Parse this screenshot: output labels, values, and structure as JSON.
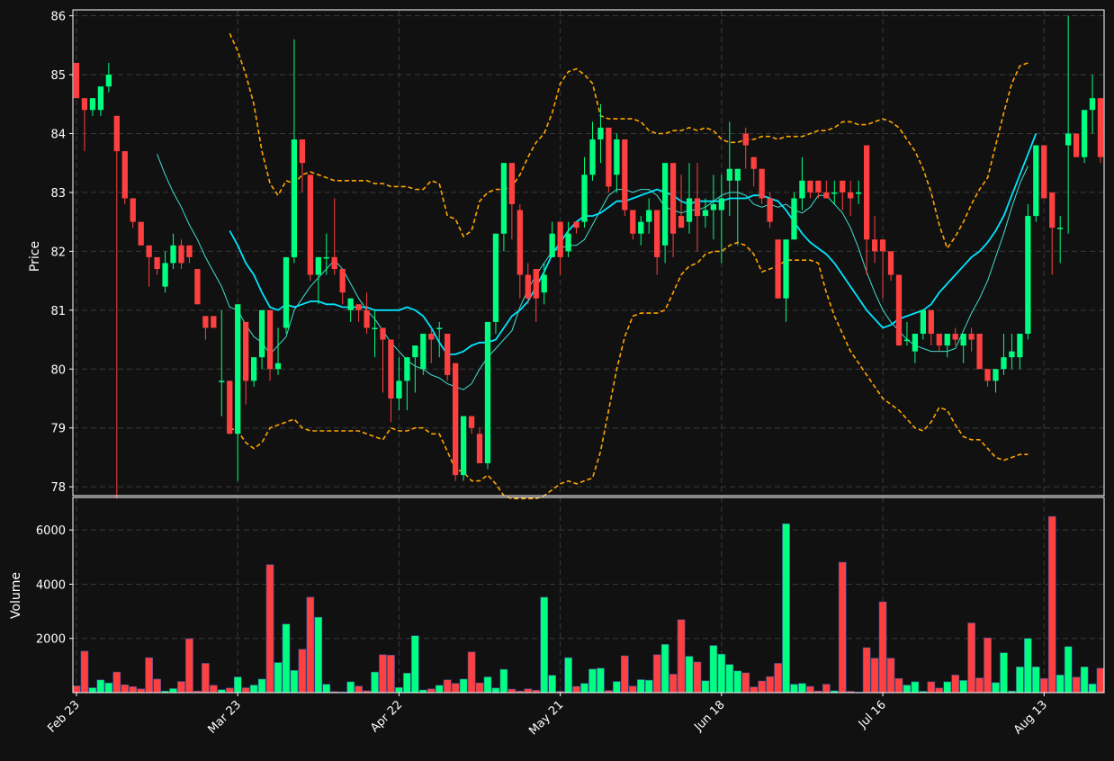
{
  "chart_data": {
    "type": "candlestick",
    "colors": {
      "background": "#111111",
      "grid": "#3a3a3a",
      "frame": "#ffffff",
      "up": "#00ff80",
      "down": "#ff4040",
      "ma_short": "#40e0d0",
      "ma_long": "#00e5ff",
      "band": "#ffa500"
    },
    "price_panel": {
      "ylabel": "Price",
      "ylim": [
        77.85,
        86.1
      ],
      "yticks": [
        78,
        79,
        80,
        81,
        82,
        83,
        84,
        85,
        86
      ]
    },
    "volume_panel": {
      "ylabel": "Volume",
      "ylim": [
        0,
        7200
      ],
      "yticks": [
        2000,
        4000,
        6000
      ]
    },
    "x_axis": {
      "ticks": [
        {
          "label": "Feb 23",
          "index": 0
        },
        {
          "label": "Mar 23",
          "index": 20
        },
        {
          "label": "Apr 22",
          "index": 40
        },
        {
          "label": "May 21",
          "index": 60
        },
        {
          "label": "Jun 18",
          "index": 80
        },
        {
          "label": "Jul 16",
          "index": 100
        },
        {
          "label": "Aug 13",
          "index": 120
        }
      ]
    },
    "candles": [
      [
        85.2,
        85.2,
        84.6,
        84.6,
        250
      ],
      [
        84.6,
        84.6,
        83.7,
        84.4,
        1530
      ],
      [
        84.4,
        84.6,
        84.3,
        84.6,
        180
      ],
      [
        84.4,
        84.8,
        84.3,
        84.8,
        470
      ],
      [
        84.8,
        85.2,
        84.7,
        85.0,
        360
      ],
      [
        84.3,
        84.3,
        77.8,
        83.7,
        760
      ],
      [
        83.7,
        83.7,
        82.8,
        82.9,
        290
      ],
      [
        82.9,
        82.9,
        82.4,
        82.5,
        220
      ],
      [
        82.5,
        82.5,
        82.1,
        82.1,
        140
      ],
      [
        82.1,
        82.1,
        81.4,
        81.9,
        1290
      ],
      [
        81.9,
        81.9,
        81.6,
        81.7,
        500
      ],
      [
        81.4,
        82.0,
        81.3,
        81.8,
        60
      ],
      [
        81.8,
        82.3,
        81.7,
        82.1,
        150
      ],
      [
        82.1,
        82.2,
        81.7,
        81.8,
        410
      ],
      [
        82.1,
        82.1,
        81.8,
        81.9,
        1990
      ],
      [
        81.7,
        81.7,
        81.1,
        81.1,
        60
      ],
      [
        80.9,
        80.9,
        80.5,
        80.7,
        1080
      ],
      [
        80.9,
        80.9,
        80.7,
        80.7,
        270
      ],
      [
        79.8,
        81.0,
        79.2,
        79.8,
        110
      ],
      [
        79.8,
        79.8,
        78.9,
        78.9,
        170
      ],
      [
        78.9,
        81.1,
        78.1,
        81.1,
        580
      ],
      [
        80.8,
        80.8,
        79.4,
        79.8,
        180
      ],
      [
        79.8,
        80.2,
        79.7,
        80.2,
        280
      ],
      [
        80.2,
        81.0,
        80.0,
        81.0,
        500
      ],
      [
        81.0,
        81.0,
        79.8,
        80.0,
        4720
      ],
      [
        80.0,
        80.7,
        79.9,
        80.1,
        1110
      ],
      [
        80.7,
        81.9,
        80.6,
        81.9,
        2530
      ],
      [
        81.9,
        85.6,
        81.8,
        83.9,
        820
      ],
      [
        83.9,
        83.9,
        83.0,
        83.5,
        1600
      ],
      [
        83.3,
        83.3,
        81.5,
        81.6,
        3520
      ],
      [
        81.6,
        81.9,
        81.1,
        81.9,
        2780
      ],
      [
        81.9,
        82.3,
        81.6,
        81.9,
        310
      ],
      [
        81.9,
        82.9,
        81.6,
        81.7,
        40
      ],
      [
        81.7,
        81.7,
        81.1,
        81.3,
        30
      ],
      [
        81.0,
        81.2,
        80.8,
        81.2,
        400
      ],
      [
        81.1,
        81.1,
        80.8,
        81.0,
        240
      ],
      [
        81.0,
        81.3,
        80.6,
        80.7,
        70
      ],
      [
        80.7,
        81.0,
        80.2,
        80.7,
        760
      ],
      [
        80.7,
        80.7,
        79.6,
        80.5,
        1400
      ],
      [
        80.5,
        80.5,
        79.1,
        79.5,
        1380
      ],
      [
        79.5,
        80.2,
        79.3,
        79.8,
        190
      ],
      [
        79.8,
        80.2,
        79.3,
        80.2,
        720
      ],
      [
        80.2,
        80.2,
        79.6,
        80.4,
        2100
      ],
      [
        80.0,
        80.6,
        79.9,
        80.6,
        100
      ],
      [
        80.6,
        80.7,
        80.1,
        80.5,
        140
      ],
      [
        80.7,
        80.8,
        80.2,
        80.7,
        270
      ],
      [
        80.6,
        80.6,
        79.8,
        79.9,
        470
      ],
      [
        80.1,
        80.1,
        78.1,
        78.2,
        340
      ],
      [
        78.2,
        79.2,
        78.1,
        79.2,
        500
      ],
      [
        79.2,
        79.2,
        78.9,
        79.0,
        1500
      ],
      [
        78.9,
        79.0,
        78.4,
        78.4,
        360
      ],
      [
        78.4,
        80.8,
        78.3,
        80.8,
        580
      ],
      [
        80.8,
        82.3,
        80.6,
        82.3,
        170
      ],
      [
        82.3,
        83.5,
        82.0,
        83.5,
        860
      ],
      [
        83.5,
        83.5,
        82.2,
        82.8,
        130
      ],
      [
        82.7,
        82.8,
        81.2,
        81.6,
        60
      ],
      [
        81.6,
        81.8,
        81.1,
        81.2,
        140
      ],
      [
        81.7,
        81.7,
        80.8,
        81.2,
        90
      ],
      [
        81.3,
        81.8,
        81.1,
        81.6,
        3520
      ],
      [
        81.9,
        82.5,
        81.9,
        82.3,
        640
      ],
      [
        82.5,
        82.5,
        81.6,
        81.9,
        50
      ],
      [
        82.0,
        82.5,
        81.9,
        82.3,
        1290
      ],
      [
        82.5,
        82.5,
        82.3,
        82.4,
        230
      ],
      [
        82.5,
        83.6,
        82.4,
        83.3,
        340
      ],
      [
        83.3,
        84.2,
        83.2,
        83.9,
        870
      ],
      [
        83.9,
        84.5,
        83.5,
        84.1,
        900
      ],
      [
        84.1,
        84.1,
        83.0,
        83.1,
        80
      ],
      [
        83.3,
        84.0,
        83.0,
        83.9,
        410
      ],
      [
        83.9,
        83.9,
        82.6,
        82.7,
        1360
      ],
      [
        82.7,
        82.7,
        82.2,
        82.3,
        240
      ],
      [
        82.3,
        82.6,
        82.1,
        82.5,
        480
      ],
      [
        82.5,
        82.9,
        82.3,
        82.7,
        460
      ],
      [
        82.7,
        82.7,
        81.6,
        81.9,
        1400
      ],
      [
        82.1,
        83.5,
        81.8,
        83.5,
        1780
      ],
      [
        83.5,
        83.5,
        81.9,
        82.3,
        680
      ],
      [
        82.6,
        83.3,
        82.4,
        82.4,
        2690
      ],
      [
        82.5,
        83.5,
        82.3,
        82.9,
        1340
      ],
      [
        82.9,
        83.5,
        82.0,
        82.6,
        1130
      ],
      [
        82.6,
        82.9,
        82.4,
        82.7,
        440
      ],
      [
        82.7,
        83.3,
        82.2,
        82.8,
        1740
      ],
      [
        82.7,
        83.3,
        81.8,
        82.9,
        1420
      ],
      [
        83.2,
        84.2,
        82.6,
        83.4,
        1040
      ],
      [
        83.2,
        83.4,
        82.1,
        83.4,
        800
      ],
      [
        84.0,
        84.1,
        83.4,
        83.8,
        730
      ],
      [
        83.6,
        83.6,
        83.1,
        83.4,
        210
      ],
      [
        83.4,
        83.4,
        82.8,
        82.9,
        430
      ],
      [
        82.9,
        83.0,
        82.4,
        82.5,
        590
      ],
      [
        82.2,
        82.2,
        81.2,
        81.2,
        1080
      ],
      [
        81.2,
        82.2,
        80.8,
        82.2,
        6230
      ],
      [
        82.2,
        83.0,
        82.2,
        82.9,
        310
      ],
      [
        82.9,
        83.6,
        82.7,
        83.2,
        340
      ],
      [
        83.2,
        83.2,
        82.9,
        83.0,
        230
      ],
      [
        83.2,
        83.2,
        82.9,
        83.0,
        60
      ],
      [
        83.0,
        83.2,
        82.9,
        82.9,
        310
      ],
      [
        83.0,
        83.2,
        82.8,
        83.0,
        70
      ],
      [
        83.2,
        83.2,
        82.7,
        83.0,
        4810
      ],
      [
        83.0,
        83.2,
        82.6,
        82.9,
        50
      ],
      [
        83.0,
        83.2,
        82.8,
        83.0,
        20
      ],
      [
        83.8,
        83.8,
        81.6,
        82.2,
        1660
      ],
      [
        82.2,
        82.6,
        81.8,
        82.0,
        1270
      ],
      [
        82.2,
        82.2,
        81.2,
        82.0,
        3350
      ],
      [
        82.0,
        82.0,
        81.5,
        81.6,
        1270
      ],
      [
        81.6,
        81.6,
        80.4,
        80.4,
        520
      ],
      [
        80.5,
        80.8,
        80.4,
        80.5,
        280
      ],
      [
        80.3,
        80.6,
        80.1,
        80.6,
        400
      ],
      [
        80.6,
        81.0,
        80.5,
        81.0,
        50
      ],
      [
        81.0,
        81.0,
        80.4,
        80.6,
        400
      ],
      [
        80.6,
        80.6,
        80.3,
        80.4,
        170
      ],
      [
        80.4,
        80.6,
        80.2,
        80.6,
        400
      ],
      [
        80.6,
        80.7,
        80.4,
        80.5,
        650
      ],
      [
        80.4,
        80.6,
        80.1,
        80.6,
        450
      ],
      [
        80.6,
        80.7,
        80.3,
        80.5,
        2570
      ],
      [
        80.6,
        80.6,
        80.0,
        80.0,
        540
      ],
      [
        80.0,
        80.0,
        79.7,
        79.8,
        2020
      ],
      [
        79.8,
        80.0,
        79.6,
        80.0,
        370
      ],
      [
        80.0,
        80.6,
        79.9,
        80.2,
        1470
      ],
      [
        80.2,
        80.6,
        80.0,
        80.3,
        60
      ],
      [
        80.2,
        80.6,
        80.0,
        80.6,
        950
      ],
      [
        80.6,
        82.8,
        80.5,
        82.6,
        2000
      ],
      [
        82.6,
        83.8,
        82.5,
        83.8,
        950
      ],
      [
        83.8,
        83.8,
        82.9,
        82.9,
        520
      ],
      [
        83.0,
        83.0,
        81.6,
        82.4,
        6500
      ],
      [
        82.4,
        82.6,
        81.8,
        82.4,
        650
      ],
      [
        83.8,
        86.0,
        82.3,
        84.0,
        1700
      ],
      [
        84.0,
        84.0,
        83.6,
        83.6,
        570
      ],
      [
        83.6,
        84.4,
        83.5,
        84.4,
        950
      ],
      [
        84.4,
        85.0,
        84.0,
        84.6,
        320
      ],
      [
        84.6,
        84.6,
        83.5,
        83.6,
        900
      ]
    ],
    "ma_short": [
      null,
      null,
      null,
      null,
      null,
      null,
      null,
      null,
      null,
      null,
      83.65,
      83.3,
      83.0,
      82.75,
      82.45,
      82.2,
      81.9,
      81.65,
      81.4,
      81.05,
      81.0,
      80.75,
      80.55,
      80.45,
      80.25,
      80.4,
      80.55,
      81.0,
      81.2,
      81.4,
      81.55,
      81.7,
      81.85,
      81.7,
      81.45,
      81.2,
      81.0,
      80.85,
      80.65,
      80.45,
      80.3,
      80.15,
      80.05,
      80.0,
      79.9,
      79.85,
      79.75,
      79.7,
      79.65,
      79.75,
      80.0,
      80.2,
      80.35,
      80.5,
      80.65,
      81.05,
      81.35,
      81.6,
      81.8,
      82.0,
      82.05,
      82.1,
      82.1,
      82.2,
      82.45,
      82.7,
      82.95,
      83.05,
      83.05,
      83.0,
      83.05,
      83.05,
      82.95,
      82.75,
      82.7,
      82.65,
      82.7,
      82.7,
      82.75,
      82.85,
      82.95,
      83.0,
      83.0,
      82.95,
      82.8,
      82.75,
      82.8,
      82.75,
      82.8,
      82.7,
      82.65,
      82.75,
      82.95,
      82.95,
      82.8,
      82.65,
      82.4,
      82.05,
      81.65,
      81.3,
      81.0,
      80.8,
      80.65,
      80.5,
      80.4,
      80.35,
      80.3,
      80.3,
      80.3,
      80.35,
      80.65,
      80.95,
      81.2,
      81.5,
      81.9,
      82.3,
      82.75,
      83.15,
      83.45
    ],
    "ma_long": [
      null,
      null,
      null,
      null,
      null,
      null,
      null,
      null,
      null,
      null,
      null,
      null,
      null,
      null,
      null,
      null,
      null,
      null,
      null,
      82.35,
      82.1,
      81.8,
      81.6,
      81.3,
      81.05,
      81.0,
      81.1,
      81.05,
      81.1,
      81.15,
      81.15,
      81.1,
      81.1,
      81.05,
      81.05,
      81.05,
      81.05,
      81.0,
      81.0,
      81.0,
      81.0,
      81.05,
      81.0,
      80.9,
      80.7,
      80.45,
      80.25,
      80.25,
      80.3,
      80.4,
      80.45,
      80.45,
      80.5,
      80.7,
      80.9,
      81.0,
      81.15,
      81.4,
      81.65,
      81.95,
      82.15,
      82.35,
      82.5,
      82.6,
      82.6,
      82.65,
      82.75,
      82.85,
      82.85,
      82.9,
      82.95,
      83.0,
      83.05,
      83.0,
      82.95,
      82.85,
      82.8,
      82.85,
      82.85,
      82.85,
      82.85,
      82.9,
      82.9,
      82.9,
      82.95,
      82.95,
      82.9,
      82.85,
      82.7,
      82.5,
      82.3,
      82.15,
      82.05,
      81.95,
      81.8,
      81.6,
      81.4,
      81.2,
      81.0,
      80.85,
      80.7,
      80.75,
      80.85,
      80.9,
      80.95,
      81.0,
      81.1,
      81.3,
      81.45,
      81.6,
      81.75,
      81.9,
      82.0,
      82.15,
      82.35,
      82.6,
      82.95,
      83.3,
      83.65,
      84.0
    ],
    "band_upper": [
      null,
      null,
      null,
      null,
      null,
      null,
      null,
      null,
      null,
      null,
      null,
      null,
      null,
      null,
      null,
      null,
      null,
      null,
      null,
      85.7,
      85.4,
      85.0,
      84.5,
      83.7,
      83.15,
      82.95,
      83.2,
      83.15,
      83.3,
      83.35,
      83.3,
      83.25,
      83.2,
      83.2,
      83.2,
      83.2,
      83.2,
      83.15,
      83.15,
      83.1,
      83.1,
      83.1,
      83.05,
      83.05,
      83.2,
      83.15,
      82.6,
      82.55,
      82.25,
      82.35,
      82.85,
      83.0,
      83.05,
      83.05,
      83.1,
      83.3,
      83.6,
      83.85,
      84.0,
      84.35,
      84.85,
      85.05,
      85.1,
      85.0,
      84.85,
      84.3,
      84.25,
      84.25,
      84.25,
      84.25,
      84.2,
      84.05,
      84.0,
      84.0,
      84.05,
      84.05,
      84.1,
      84.05,
      84.1,
      84.05,
      83.9,
      83.85,
      83.85,
      83.9,
      83.9,
      83.95,
      83.95,
      83.9,
      83.95,
      83.95,
      83.95,
      84.0,
      84.05,
      84.05,
      84.1,
      84.2,
      84.2,
      84.15,
      84.15,
      84.2,
      84.25,
      84.2,
      84.1,
      83.9,
      83.7,
      83.4,
      83.0,
      82.45,
      82.05,
      82.25,
      82.5,
      82.8,
      83.05,
      83.25,
      83.8,
      84.35,
      84.85,
      85.15,
      85.2
    ],
    "band_lower": [
      null,
      null,
      null,
      null,
      null,
      null,
      null,
      null,
      null,
      null,
      null,
      null,
      null,
      null,
      null,
      null,
      null,
      null,
      null,
      79.0,
      78.95,
      78.75,
      78.65,
      78.75,
      79.0,
      79.05,
      79.1,
      79.15,
      79.0,
      78.95,
      78.95,
      78.95,
      78.95,
      78.95,
      78.95,
      78.95,
      78.9,
      78.85,
      78.8,
      79.0,
      78.95,
      78.95,
      79.0,
      79.0,
      78.9,
      78.9,
      78.6,
      78.3,
      78.25,
      78.1,
      78.1,
      78.2,
      78.05,
      77.85,
      77.8,
      77.8,
      77.8,
      77.8,
      77.85,
      77.95,
      78.05,
      78.1,
      78.05,
      78.1,
      78.15,
      78.6,
      79.3,
      80.0,
      80.55,
      80.9,
      80.95,
      80.95,
      80.95,
      81.0,
      81.3,
      81.6,
      81.75,
      81.8,
      81.95,
      82.0,
      82.0,
      82.1,
      82.15,
      82.1,
      81.95,
      81.65,
      81.7,
      81.75,
      81.85,
      81.85,
      81.85,
      81.85,
      81.8,
      81.3,
      80.9,
      80.6,
      80.3,
      80.1,
      79.9,
      79.7,
      79.5,
      79.4,
      79.3,
      79.15,
      79.0,
      78.95,
      79.1,
      79.35,
      79.3,
      79.05,
      78.85,
      78.8,
      78.8,
      78.65,
      78.5,
      78.45,
      78.5,
      78.55,
      78.55
    ]
  }
}
